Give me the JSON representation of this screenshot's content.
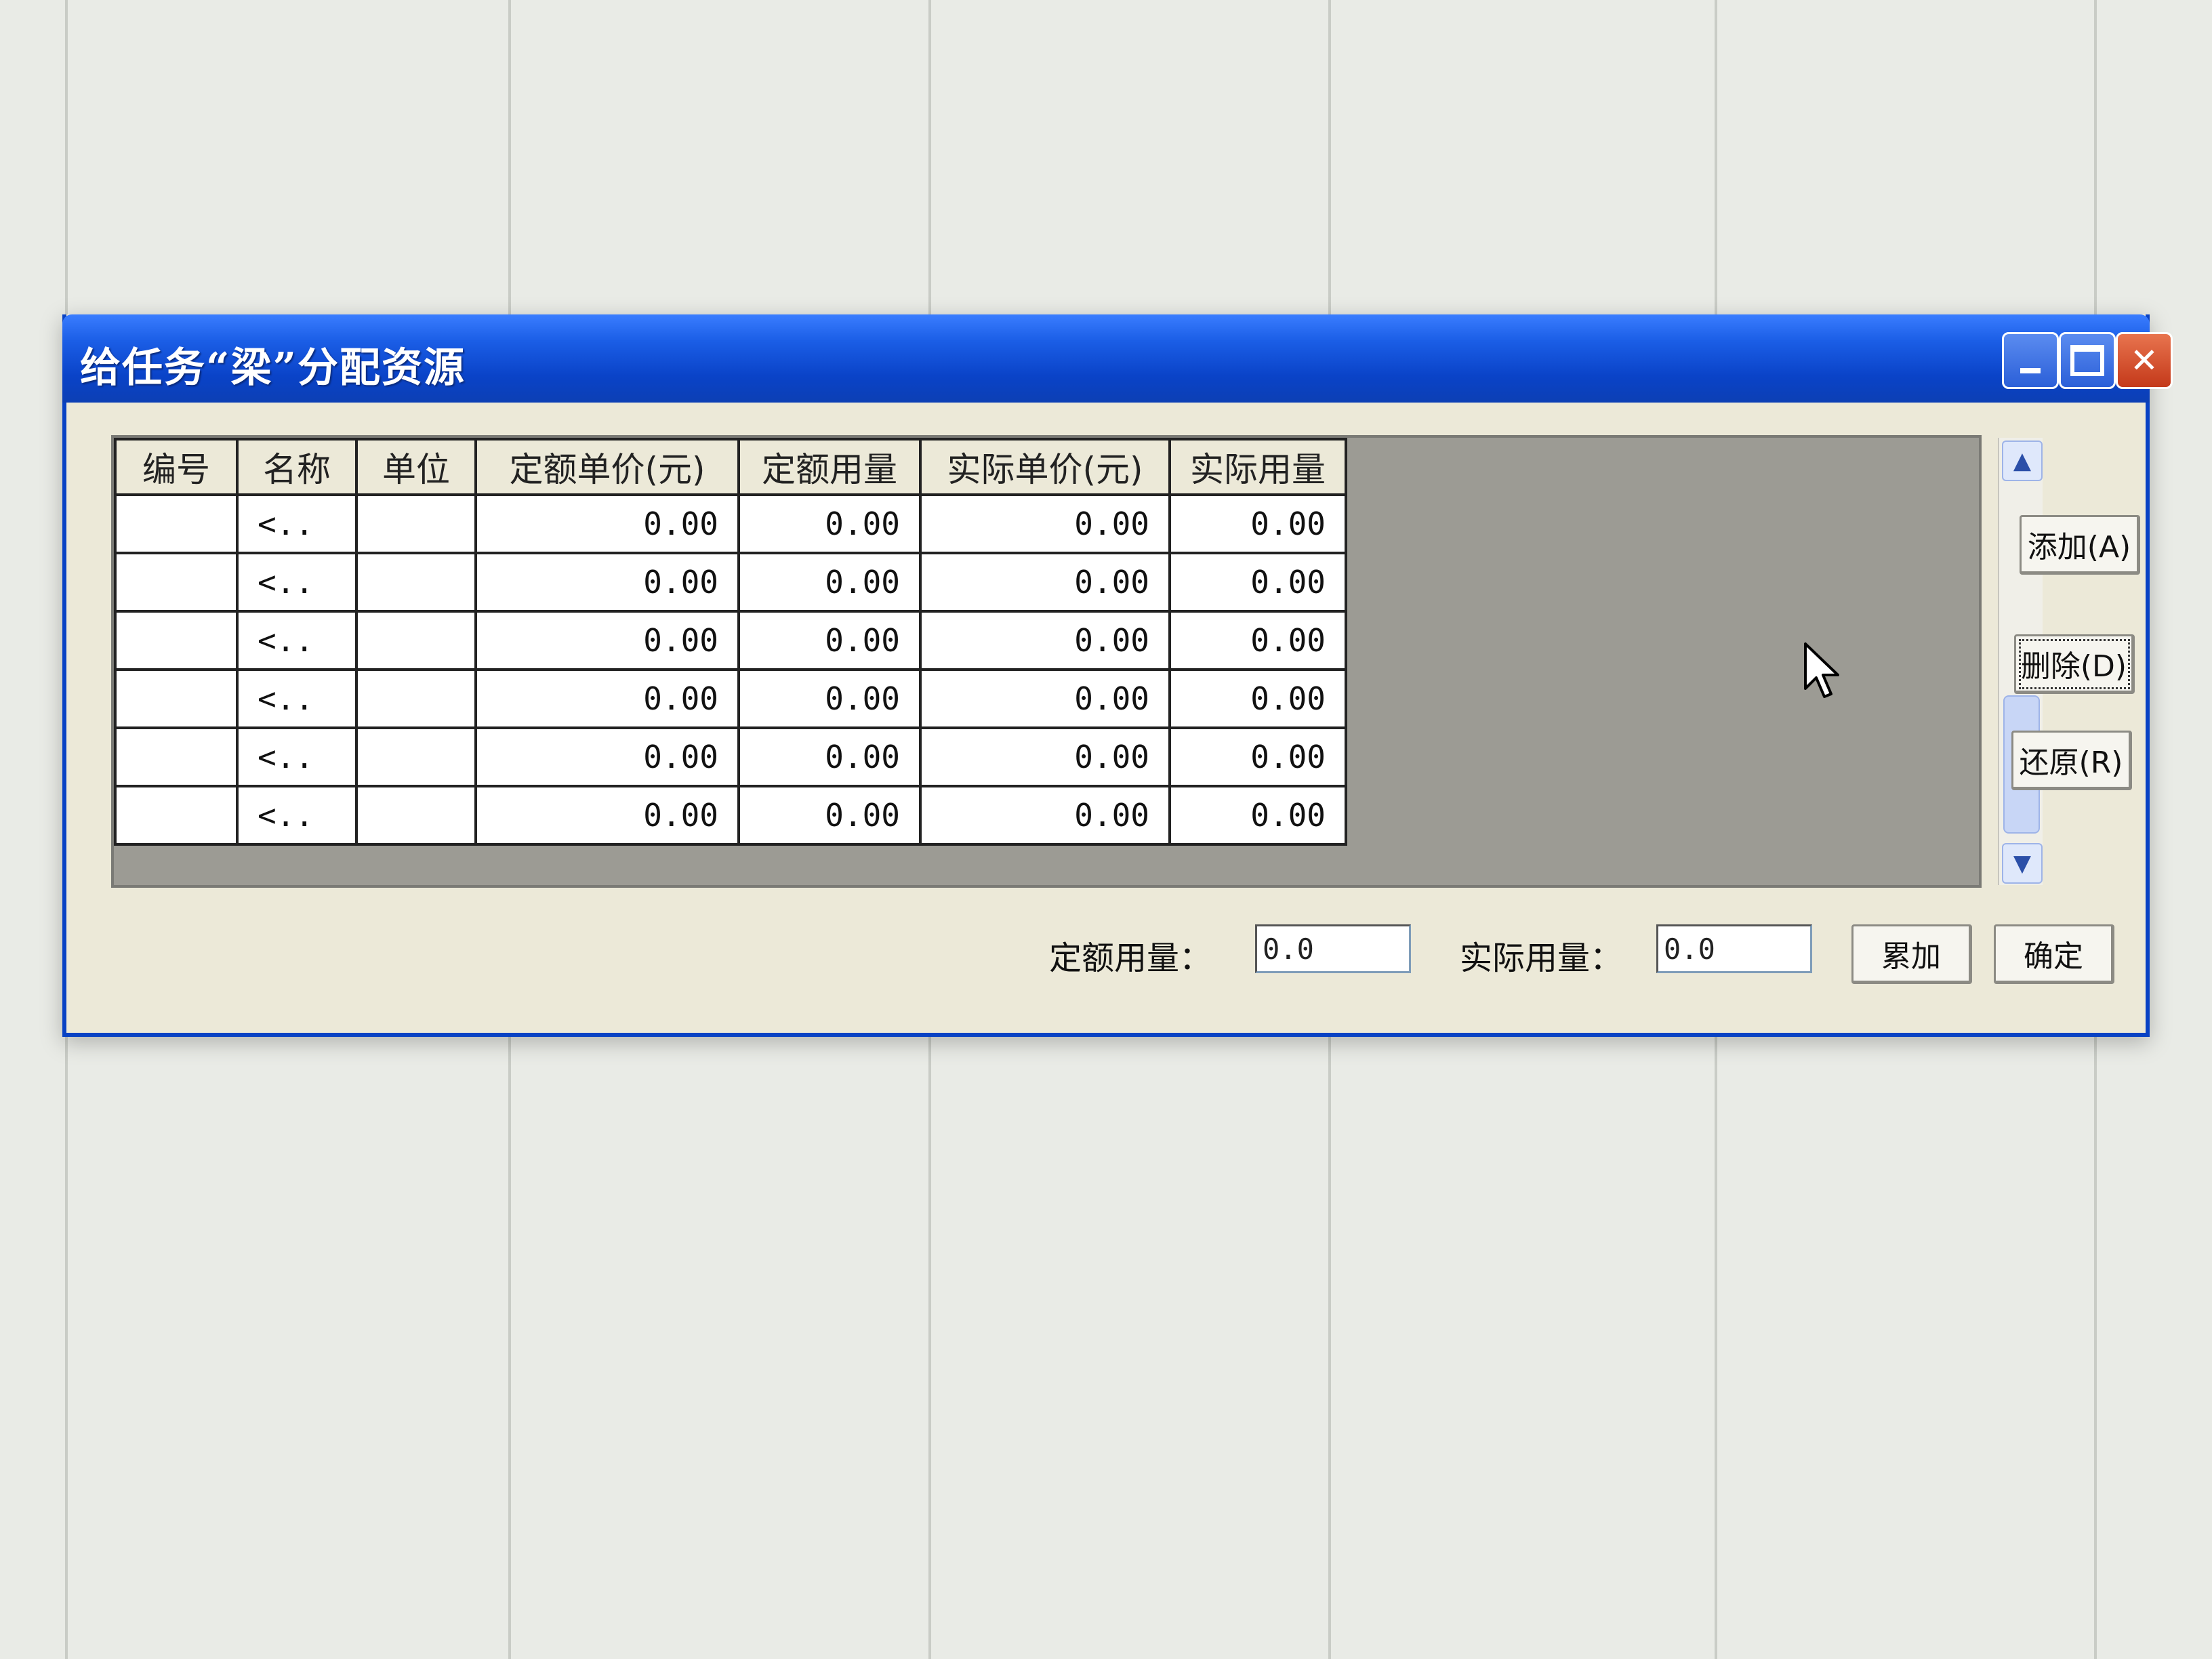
{
  "window": {
    "title": "给任务“梁”分配资源",
    "minimize_glyph": "_",
    "close_glyph": "✕"
  },
  "grid": {
    "columns": [
      "编号",
      "名称",
      "单位",
      "定额单价(元)",
      "定额用量",
      "实际单价(元)",
      "实际用量"
    ],
    "rows": [
      {
        "code": "",
        "name": "<..",
        "unit": "",
        "quota_price": "0.00",
        "quota_qty": "0.00",
        "actual_price": "0.00",
        "actual_qty": "0.00"
      },
      {
        "code": "",
        "name": "<..",
        "unit": "",
        "quota_price": "0.00",
        "quota_qty": "0.00",
        "actual_price": "0.00",
        "actual_qty": "0.00"
      },
      {
        "code": "",
        "name": "<..",
        "unit": "",
        "quota_price": "0.00",
        "quota_qty": "0.00",
        "actual_price": "0.00",
        "actual_qty": "0.00"
      },
      {
        "code": "",
        "name": "<..",
        "unit": "",
        "quota_price": "0.00",
        "quota_qty": "0.00",
        "actual_price": "0.00",
        "actual_qty": "0.00"
      },
      {
        "code": "",
        "name": "<..",
        "unit": "",
        "quota_price": "0.00",
        "quota_qty": "0.00",
        "actual_price": "0.00",
        "actual_qty": "0.00"
      },
      {
        "code": "",
        "name": "<..",
        "unit": "",
        "quota_price": "0.00",
        "quota_qty": "0.00",
        "actual_price": "0.00",
        "actual_qty": "0.00"
      }
    ]
  },
  "buttons": {
    "add": "添加(A)",
    "delete": "删除(D)",
    "restore": "还原(R)",
    "accumulate": "累加",
    "ok": "确定"
  },
  "summary": {
    "quota_label": "定额用量：",
    "quota_value": "0.0",
    "actual_label": "实际用量：",
    "actual_value": "0.0"
  },
  "icons": {
    "scroll_up": "chevron-up-icon",
    "scroll_down": "chevron-down-icon",
    "cursor": "mouse-pointer-icon"
  }
}
